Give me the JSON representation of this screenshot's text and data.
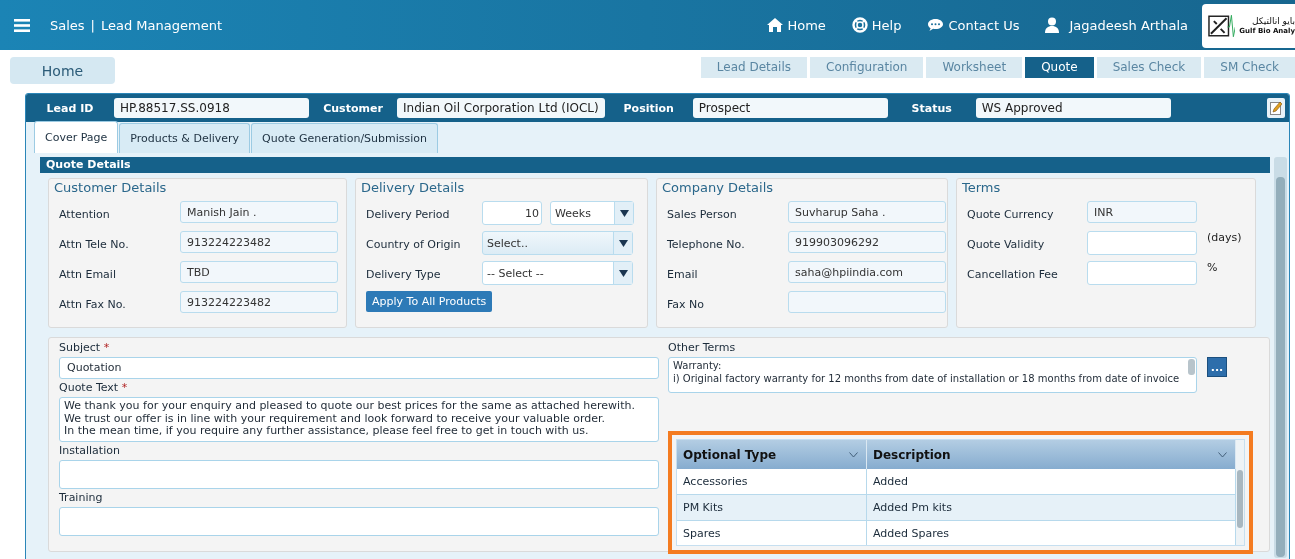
{
  "header": {
    "module": "Sales",
    "separator": "|",
    "title": "Lead Management",
    "nav": [
      {
        "label": "Home",
        "kind": "link"
      },
      {
        "label": "Help",
        "kind": "link"
      },
      {
        "label": "Contact Us",
        "kind": "link"
      },
      {
        "label": "Jagadeesh Arthala",
        "kind": "user"
      }
    ],
    "logo": {
      "native": "بايو انالتيكل",
      "english": "Gulf Bio Analy"
    }
  },
  "home_button": "Home",
  "steps": [
    {
      "label": "Lead Details",
      "selected": false
    },
    {
      "label": "Configuration",
      "selected": false
    },
    {
      "label": "Worksheet",
      "selected": false
    },
    {
      "label": "Quote",
      "selected": true
    },
    {
      "label": "Sales Check",
      "selected": false
    },
    {
      "label": "SM Check",
      "selected": false
    }
  ],
  "lead_bar": [
    {
      "label": "Lead ID",
      "value": "HP.88517.SS.0918"
    },
    {
      "label": "Customer",
      "value": "Indian Oil Corporation Ltd (IOCL)"
    },
    {
      "label": "Position",
      "value": "Prospect"
    },
    {
      "label": "Status",
      "value": "WS Approved"
    }
  ],
  "tabs": [
    {
      "label": "Cover Page",
      "selected": true
    },
    {
      "label": "Products & Delivery",
      "selected": false
    },
    {
      "label": "Quote Generation/Submission",
      "selected": false
    }
  ],
  "section_title": "Quote Details",
  "groups": [
    {
      "title": "Customer Details",
      "rows": [
        {
          "label": "Attention",
          "kind": "readonly",
          "value": "Manish Jain ."
        },
        {
          "label": "Attn Tele No.",
          "kind": "readonly",
          "value": "913224223482"
        },
        {
          "label": "Attn Email",
          "kind": "readonly",
          "value": "TBD"
        },
        {
          "label": "Attn Fax No.",
          "kind": "readonly",
          "value": "913224223482"
        }
      ]
    },
    {
      "title": "Delivery Details",
      "rows": [
        {
          "label": "Delivery Period",
          "kind": "period",
          "value": "10",
          "option": "Weeks"
        },
        {
          "label": "Country of Origin",
          "kind": "select",
          "value": "Select..",
          "highlighted": true
        },
        {
          "label": "Delivery Type",
          "kind": "select",
          "value": "-- Select --",
          "highlighted": false
        }
      ],
      "button": "Apply To All Products"
    },
    {
      "title": "Company Details",
      "rows": [
        {
          "label": "Sales Person",
          "kind": "readonly",
          "value": "Suvharup Saha ."
        },
        {
          "label": "Telephone No.",
          "kind": "readonly",
          "value": "919903096292"
        },
        {
          "label": "Email",
          "kind": "readonly",
          "value": "saha@hpiindia.com"
        },
        {
          "label": "Fax No",
          "kind": "readonly"
        }
      ]
    },
    {
      "title": "Terms",
      "rows": [
        {
          "label": "Quote Currency",
          "kind": "readonly",
          "value": "INR"
        },
        {
          "label": "Quote Validity",
          "kind": "input",
          "suffix": "(days)"
        },
        {
          "label": "Cancellation Fee",
          "kind": "input",
          "suffix": "%"
        }
      ]
    }
  ],
  "required_mark": "*",
  "quote_form": [
    {
      "label": "Subject",
      "required": true,
      "kind": "input",
      "value": "Quotation"
    },
    {
      "label": "Quote Text",
      "required": true,
      "kind": "textarea",
      "value": "We thank you for your enquiry and pleased to quote our best prices for the same as attached herewith.\nWe trust our offer is in line with your requirement and look forward to receive your valuable order.\nIn the mean time, if you require any further assistance, please feel free to get in touch with us."
    },
    {
      "label": "Installation",
      "required": false,
      "kind": "textarea"
    },
    {
      "label": "Training",
      "required": false,
      "kind": "textarea"
    }
  ],
  "other_terms": {
    "label": "Other Terms",
    "value": "Warranty:\ni) Original factory warranty for 12 months from date of installation or 18 months from date of invoice",
    "button": "..."
  },
  "options_grid": {
    "highlighted": true,
    "columns": [
      "Optional Type",
      "Description"
    ],
    "rows": [
      [
        "Accessories",
        "Added"
      ],
      [
        "PM Kits",
        "Added Pm kits"
      ],
      [
        "Spares",
        "Added Spares"
      ]
    ]
  }
}
